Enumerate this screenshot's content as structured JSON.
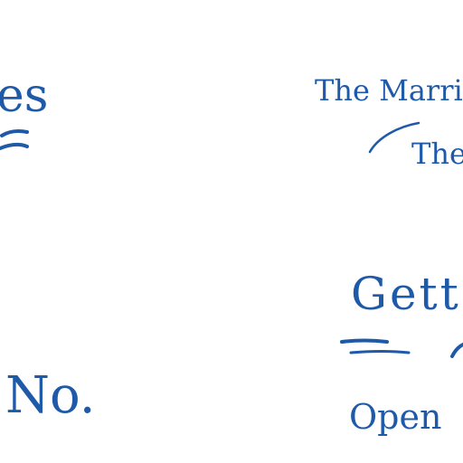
{
  "fragments": {
    "es": "es",
    "marri": "The Marri",
    "the": "The",
    "gett": "Gett",
    "no": "No.",
    "open": "Open"
  },
  "colors": {
    "ink": "#1e5aa8"
  }
}
